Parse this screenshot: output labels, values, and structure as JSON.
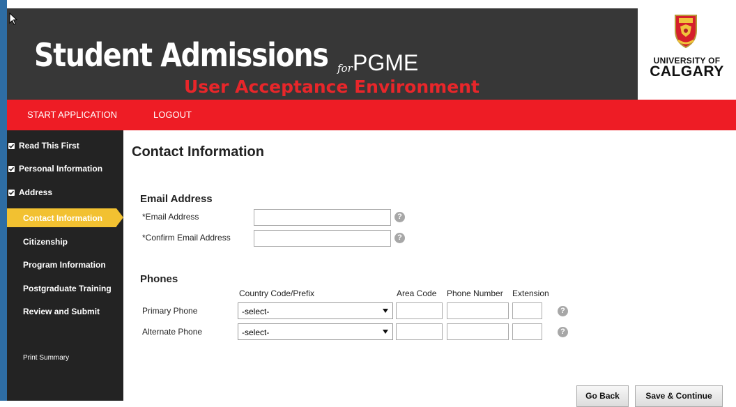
{
  "header": {
    "brand": "Student Admissions",
    "for_word": "for",
    "program": "PGME",
    "environment": "User Acceptance Environment",
    "university_line1": "UNIVERSITY OF",
    "university_line2": "CALGARY"
  },
  "topnav": {
    "start_application": "START APPLICATION",
    "logout": "LOGOUT"
  },
  "sidebar": {
    "items": [
      {
        "label": "Read This First",
        "checked": true
      },
      {
        "label": "Personal Information",
        "checked": true
      },
      {
        "label": "Address",
        "checked": true
      },
      {
        "label": "Contact Information",
        "active": true
      },
      {
        "label": "Citizenship"
      },
      {
        "label": "Program Information"
      },
      {
        "label": "Postgraduate Training"
      },
      {
        "label": "Review and Submit"
      }
    ],
    "print_summary": "Print Summary"
  },
  "main": {
    "title": "Contact Information",
    "email": {
      "heading": "Email Address",
      "email_label": "*Email Address",
      "email_value": "",
      "confirm_label": "*Confirm Email Address",
      "confirm_value": ""
    },
    "phones": {
      "heading": "Phones",
      "col_country": "Country Code/Prefix",
      "col_area": "Area Code",
      "col_number": "Phone Number",
      "col_ext": "Extension",
      "primary_label": "Primary Phone",
      "primary_select": "-select-",
      "alternate_label": "Alternate Phone",
      "alternate_select": "-select-"
    },
    "help_glyph": "?",
    "buttons": {
      "go_back": "Go Back",
      "save_continue": "Save & Continue"
    }
  },
  "colors": {
    "header_bg": "#373737",
    "nav_red": "#ee1c25",
    "env_red": "#e8262a",
    "sidebar_bg": "#232323",
    "active_yellow": "#f2c131"
  },
  "icons": [
    "checkbox-icon",
    "help-icon",
    "chevron-down-icon",
    "university-crest-icon",
    "mouse-cursor-icon"
  ]
}
